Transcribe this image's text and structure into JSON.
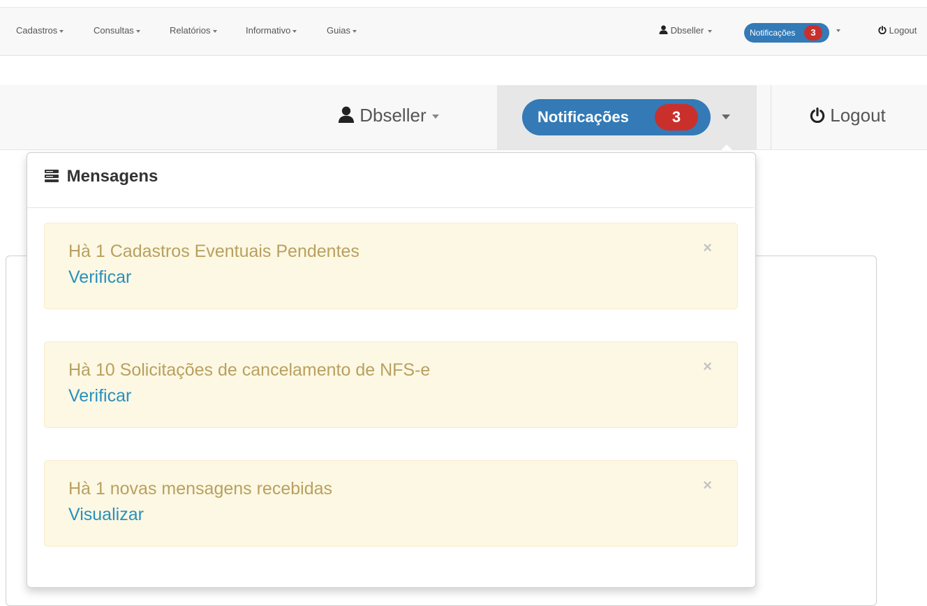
{
  "topbar": {
    "menus": [
      "Cadastros",
      "Consultas",
      "Relatórios",
      "Informativo",
      "Guias"
    ],
    "user": "Dbseller",
    "notifications_label": "Notificações",
    "notifications_count": "3",
    "logout": "Logout"
  },
  "header": {
    "user": "Dbseller",
    "notifications_label": "Notificações",
    "notifications_count": "3",
    "logout": "Logout"
  },
  "dropdown": {
    "title": "Mensagens",
    "alerts": [
      {
        "text": "Hà 1 Cadastros Eventuais Pendentes",
        "link": "Verificar"
      },
      {
        "text": "Hà 10 Solicitações de cancelamento de NFS-e",
        "link": "Verificar"
      },
      {
        "text": "Hà 1 novas mensagens recebidas",
        "link": "Visualizar"
      }
    ],
    "close_glyph": "×"
  },
  "colors": {
    "primary": "#337ab7",
    "badge": "#c9302c",
    "alert_bg": "#fcf8e3",
    "alert_text": "#b9a060",
    "link": "#2a8fbd"
  }
}
